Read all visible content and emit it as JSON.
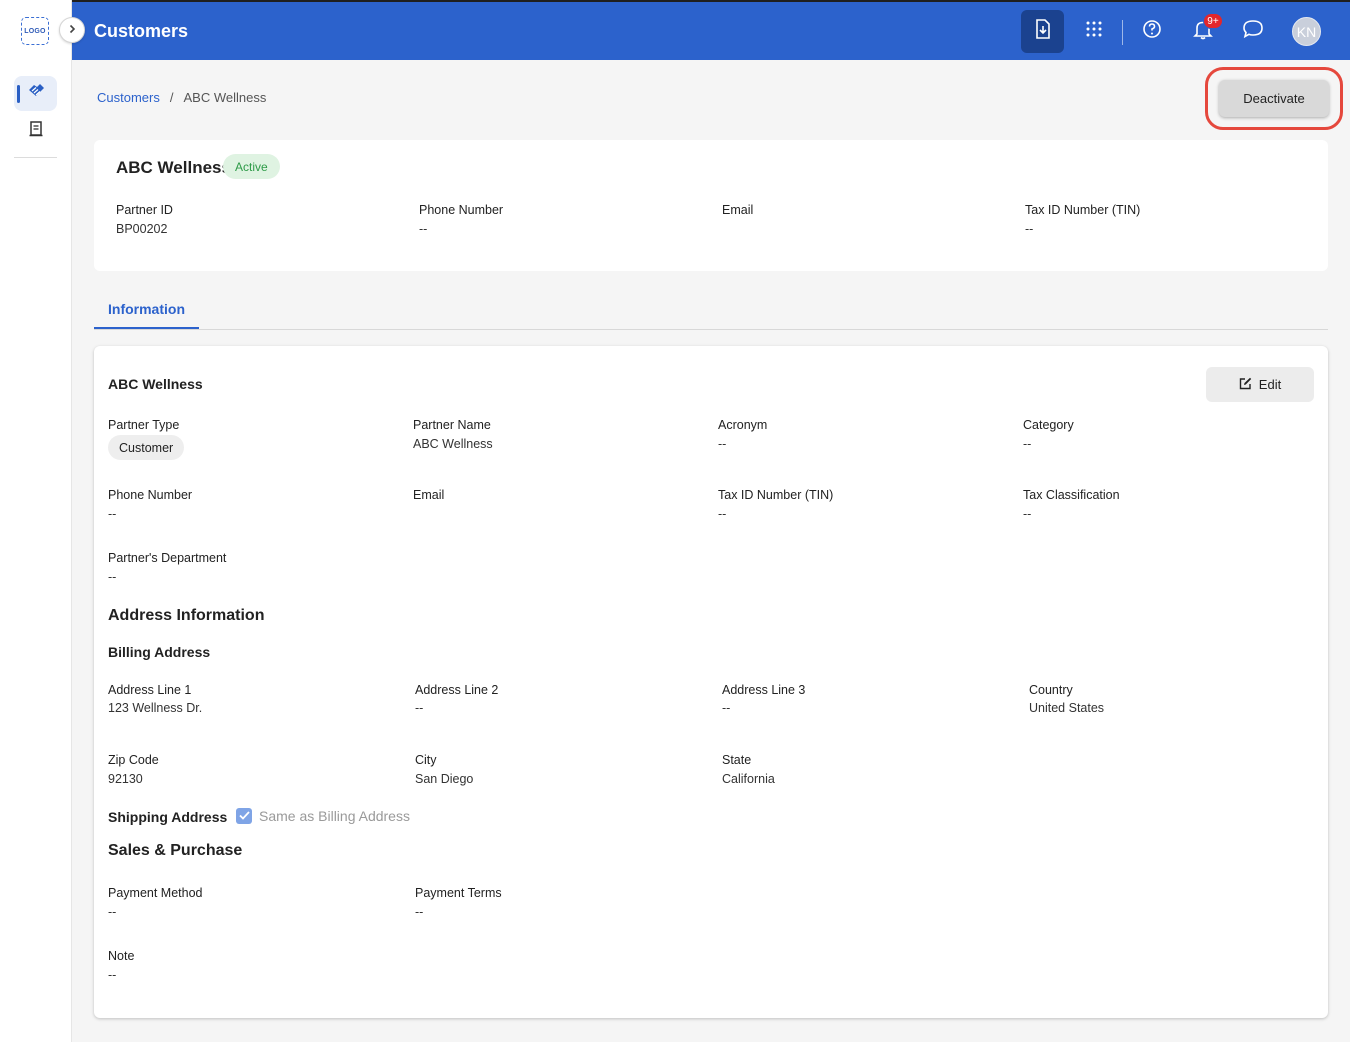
{
  "sidebar": {
    "logo_text": "LOGO",
    "items": [
      {
        "name": "partners",
        "icon": "handshake-icon",
        "active": true
      },
      {
        "name": "documents",
        "icon": "receipt-icon",
        "active": false
      }
    ]
  },
  "topbar": {
    "title": "Customers",
    "notification_badge": "9+",
    "avatar_initials": "KN",
    "icons": [
      "download-icon",
      "apps-grid-icon",
      "help-icon",
      "bell-icon",
      "chat-icon"
    ]
  },
  "breadcrumb": {
    "parent": "Customers",
    "separator": "/",
    "current": "ABC Wellness"
  },
  "actions": {
    "deactivate_label": "Deactivate"
  },
  "summary": {
    "name": "ABC Wellness",
    "status": "Active",
    "fields": [
      {
        "label": "Partner ID",
        "value": "BP00202"
      },
      {
        "label": "Phone Number",
        "value": "--"
      },
      {
        "label": "Email",
        "value": ""
      },
      {
        "label": "Tax ID Number (TIN)",
        "value": "--"
      }
    ]
  },
  "tabs": [
    {
      "label": "Information",
      "active": true
    }
  ],
  "info": {
    "title": "ABC Wellness",
    "edit_label": "Edit",
    "partner_type_label": "Partner Type",
    "partner_type_value": "Customer",
    "fields": [
      {
        "label": "Partner Name",
        "value": "ABC Wellness"
      },
      {
        "label": "Acronym",
        "value": "--"
      },
      {
        "label": "Category",
        "value": "--"
      },
      {
        "label": "Phone Number",
        "value": "--"
      },
      {
        "label": "Email",
        "value": ""
      },
      {
        "label": "Tax ID Number (TIN)",
        "value": "--"
      },
      {
        "label": "Tax Classification",
        "value": "--"
      },
      {
        "label": "Partner's Department",
        "value": "--"
      }
    ],
    "address_title": "Address Information",
    "billing_title": "Billing Address",
    "billing": [
      {
        "label": "Address Line 1",
        "value": "123 Wellness Dr."
      },
      {
        "label": "Address Line 2",
        "value": "--"
      },
      {
        "label": "Address Line 3",
        "value": "--"
      },
      {
        "label": "Country",
        "value": "United States"
      },
      {
        "label": "Zip Code",
        "value": "92130"
      },
      {
        "label": "City",
        "value": "San Diego"
      },
      {
        "label": "State",
        "value": "California"
      }
    ],
    "shipping_title": "Shipping Address",
    "same_as_billing_label": "Same as Billing Address",
    "same_as_billing_checked": true,
    "sales_title": "Sales & Purchase",
    "sales": [
      {
        "label": "Payment Method",
        "value": "--"
      },
      {
        "label": "Payment Terms",
        "value": "--"
      },
      {
        "label": "Note",
        "value": "--"
      }
    ]
  },
  "colors": {
    "primary": "#2c62cc",
    "primary_dark": "#1b428f",
    "active_green": "#2e9b48",
    "highlight_red": "#e5483d"
  }
}
